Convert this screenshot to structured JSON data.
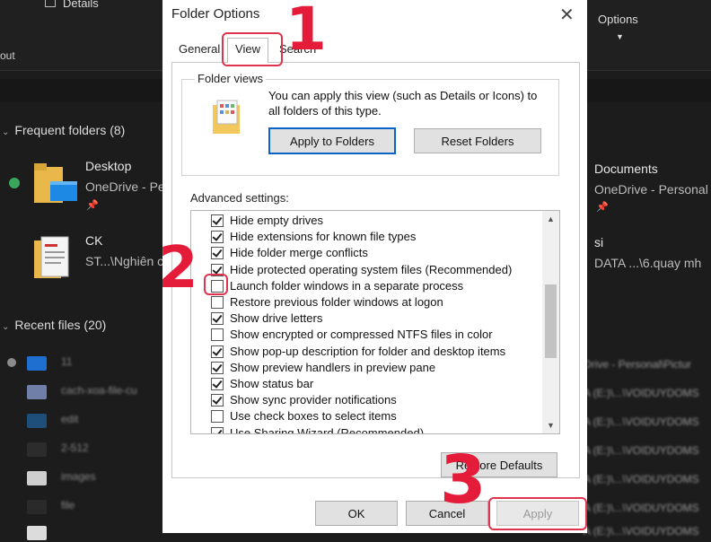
{
  "background": {
    "toolbar": {
      "details_label": "Details",
      "options_label": "Options",
      "out_label": "out"
    },
    "frequent_folders": {
      "title": "Frequent folders (8)",
      "items": [
        {
          "name": "Desktop",
          "location": "OneDrive - Pe"
        },
        {
          "name": "Documents",
          "location": "OneDrive - Personal"
        },
        {
          "name": "CK",
          "location": "ST...\\Nghiên c"
        },
        {
          "name": "si",
          "location": "DATA ...\\6.quay mh"
        }
      ]
    },
    "recent_files": {
      "title": "Recent files (20)",
      "items": [
        "11",
        "cach-xoa-file-cu",
        "edit",
        "2-512",
        "images",
        "file",
        ""
      ],
      "right_column": [
        "Drive - Personal\\Pictur",
        "A (E:)\\...\\VOIDUYDOMS",
        "A (E:)\\...\\VOIDUYDOMS",
        "A (E:)\\...\\VOIDUYDOMS",
        "A (E:)\\...\\VOIDUYDOMS",
        "A (E:)\\...\\VOIDUYDOMS",
        "A (E:)\\...\\VOIDUYDOMS"
      ]
    }
  },
  "dialog": {
    "title": "Folder Options",
    "tabs": [
      {
        "label": "General",
        "active": false
      },
      {
        "label": "View",
        "active": true
      },
      {
        "label": "Search",
        "active": false
      }
    ],
    "folder_views": {
      "group_label": "Folder views",
      "description": "You can apply this view (such as Details or Icons) to all folders of this type.",
      "apply_button": "Apply to Folders",
      "reset_button": "Reset Folders"
    },
    "advanced": {
      "label": "Advanced settings:",
      "options": [
        {
          "label": "Hide empty drives",
          "checked": true
        },
        {
          "label": "Hide extensions for known file types",
          "checked": true
        },
        {
          "label": "Hide folder merge conflicts",
          "checked": true
        },
        {
          "label": "Hide protected operating system files (Recommended)",
          "checked": true
        },
        {
          "label": "Launch folder windows in a separate process",
          "checked": false
        },
        {
          "label": "Restore previous folder windows at logon",
          "checked": false
        },
        {
          "label": "Show drive letters",
          "checked": true
        },
        {
          "label": "Show encrypted or compressed NTFS files in color",
          "checked": false
        },
        {
          "label": "Show pop-up description for folder and desktop items",
          "checked": true
        },
        {
          "label": "Show preview handlers in preview pane",
          "checked": true
        },
        {
          "label": "Show status bar",
          "checked": true
        },
        {
          "label": "Show sync provider notifications",
          "checked": true
        },
        {
          "label": "Use check boxes to select items",
          "checked": false
        },
        {
          "label": "Use Sharing Wizard (Recommended)",
          "checked": true
        }
      ]
    },
    "restore_defaults_button": "Restore Defaults",
    "ok_button": "OK",
    "cancel_button": "Cancel",
    "apply_button": "Apply"
  },
  "annotations": {
    "step1": "1",
    "step2": "2",
    "step3": "3"
  },
  "colors": {
    "annotation": "#e51b3a",
    "dark_bg": "#1c1c1c",
    "focus_border": "#0a64c8"
  }
}
